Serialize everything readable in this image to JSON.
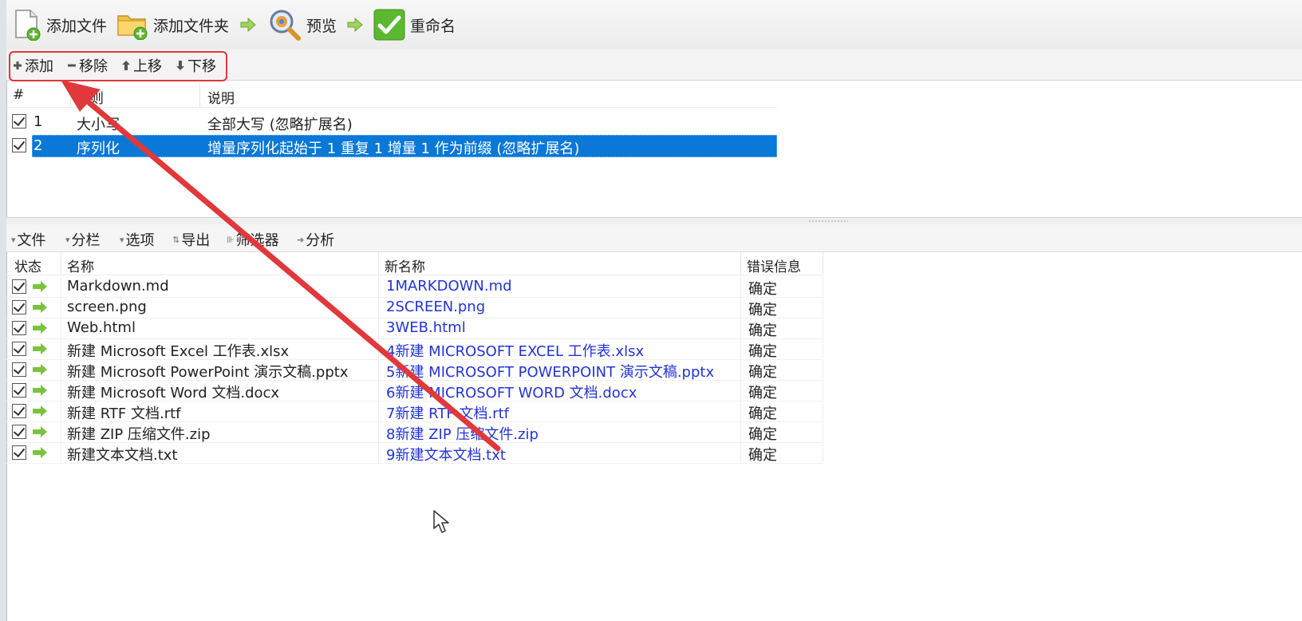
{
  "toolbar": {
    "add_files": "添加文件",
    "add_folders": "添加文件夹",
    "preview": "预览",
    "rename": "重命名"
  },
  "rules_toolbar": {
    "add": "添加",
    "remove": "移除",
    "move_up": "上移",
    "move_down": "下移"
  },
  "rules_table": {
    "headers": {
      "index": "#",
      "rule": "规则",
      "description": "说明"
    },
    "rows": [
      {
        "index": "1",
        "rule": "大小写",
        "description": "全部大写 (忽略扩展名)",
        "checked": true,
        "selected": false
      },
      {
        "index": "2",
        "rule": "序列化",
        "description": "增量序列化起始于 1 重复 1 增量 1 作为前缀 (忽略扩展名)",
        "checked": true,
        "selected": true
      }
    ]
  },
  "files_toolbar": {
    "files": "文件",
    "columns": "分栏",
    "options": "选项",
    "export": "导出",
    "filter": "筛选器",
    "analyze": "分析"
  },
  "files_table": {
    "headers": {
      "state": "状态",
      "name": "名称",
      "new_name": "新名称",
      "error": "错误信息"
    },
    "rows": [
      {
        "name": "Markdown.md",
        "new_name": "1MARKDOWN.md",
        "error": "确定"
      },
      {
        "name": "screen.png",
        "new_name": "2SCREEN.png",
        "error": "确定"
      },
      {
        "name": "Web.html",
        "new_name": "3WEB.html",
        "error": "确定"
      },
      {
        "name": "新建 Microsoft Excel 工作表.xlsx",
        "new_name": "4新建 MICROSOFT EXCEL 工作表.xlsx",
        "error": "确定"
      },
      {
        "name": "新建 Microsoft PowerPoint 演示文稿.pptx",
        "new_name": "5新建 MICROSOFT POWERPOINT 演示文稿.pptx",
        "error": "确定"
      },
      {
        "name": "新建 Microsoft Word 文档.docx",
        "new_name": "6新建 MICROSOFT WORD 文档.docx",
        "error": "确定"
      },
      {
        "name": "新建 RTF 文档.rtf",
        "new_name": "7新建 RTF 文档.rtf",
        "error": "确定"
      },
      {
        "name": "新建 ZIP 压缩文件.zip",
        "new_name": "8新建 ZIP 压缩文件.zip",
        "error": "确定"
      },
      {
        "name": "新建文本文档.txt",
        "new_name": "9新建文本文档.txt",
        "error": "确定"
      }
    ]
  },
  "colors": {
    "selection": "#0a78d7",
    "new_name_text": "#2234d8",
    "annotation_red": "#e0383b",
    "status_arrow_green": "#7bc142",
    "rename_green": "#5cb82f"
  },
  "icons": {
    "add_files": "file-add-icon",
    "add_folders": "folder-add-icon",
    "preview": "magnifier-icon",
    "rename": "checkmark-icon"
  }
}
